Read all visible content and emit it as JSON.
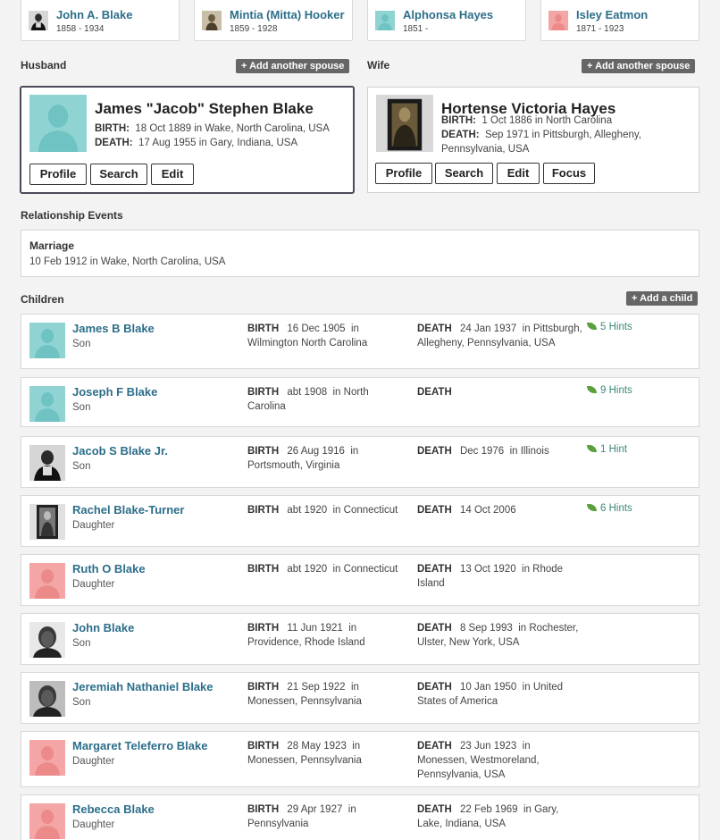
{
  "parents": [
    {
      "name": "John A. Blake",
      "years": "1858 - 1934",
      "avatar": "photo-dark"
    },
    {
      "name": "Mintia (Mitta) Hooker",
      "years": "1859 - 1928",
      "avatar": "photo-sepia"
    },
    {
      "name": "Alphonsa Hayes",
      "years": "1851 -",
      "avatar": "male"
    },
    {
      "name": "Isley Eatmon",
      "years": "1871 - 1923",
      "avatar": "female"
    }
  ],
  "husband": {
    "section_label": "Husband",
    "add_spouse_label": "+ Add another spouse",
    "name": "James \"Jacob\" Stephen Blake",
    "birth_label": "BIRTH:",
    "birth": "18 Oct 1889 in Wake, North Carolina, USA",
    "death_label": "DEATH:",
    "death": "17 Aug 1955 in Gary, Indiana, USA",
    "buttons": {
      "profile": "Profile",
      "search": "Search",
      "edit": "Edit"
    }
  },
  "wife": {
    "section_label": "Wife",
    "add_spouse_label": "+ Add another spouse",
    "name": "Hortense Victoria Hayes",
    "birth_label": "BIRTH:",
    "birth": "1 Oct 1886 in North Carolina",
    "death_label": "DEATH:",
    "death": "Sep 1971 in Pittsburgh, Allegheny, Pennsylvania, USA",
    "buttons": {
      "profile": "Profile",
      "search": "Search",
      "edit": "Edit",
      "focus": "Focus"
    }
  },
  "relationship_events": {
    "section_label": "Relationship Events",
    "title": "Marriage",
    "detail": "10 Feb 1912 in Wake, North Carolina, USA"
  },
  "children_section": {
    "label": "Children",
    "add_child_label": "+ Add a child",
    "birth_label": "BIRTH",
    "death_label": "DEATH"
  },
  "children": [
    {
      "name": "James B Blake",
      "relation": "Son",
      "birth": "16 Dec 1905",
      "birth_place": "in Wilmington North Carolina",
      "death": "24 Jan 1937",
      "death_place": "in Pittsburgh, Allegheny, Pennsylvania, USA",
      "hints": "5 Hints",
      "avatar": "male"
    },
    {
      "name": "Joseph F Blake",
      "relation": "Son",
      "birth": "abt 1908",
      "birth_place": "in North Carolina",
      "death": "",
      "death_place": "",
      "hints": "9 Hints",
      "avatar": "male"
    },
    {
      "name": "Jacob S Blake Jr.",
      "relation": "Son",
      "birth": "26 Aug 1916",
      "birth_place": "in Portsmouth, Virginia",
      "death": "Dec 1976",
      "death_place": "in Illinois",
      "hints": "1 Hint",
      "avatar": "photo-dark"
    },
    {
      "name": "Rachel Blake-Turner",
      "relation": "Daughter",
      "birth": "abt 1920",
      "birth_place": "in Connecticut",
      "death": "14 Oct 2006",
      "death_place": "",
      "hints": "6 Hints",
      "avatar": "photo-bw"
    },
    {
      "name": "Ruth O Blake",
      "relation": "Daughter",
      "birth": "abt 1920",
      "birth_place": "in Connecticut",
      "death": "13 Oct 1920",
      "death_place": "in Rhode Island",
      "hints": "",
      "avatar": "female"
    },
    {
      "name": "John Blake",
      "relation": "Son",
      "birth": "11 Jun 1921",
      "birth_place": "in Providence, Rhode Island",
      "death": "8 Sep 1993",
      "death_place": "in Rochester, Ulster, New York, USA",
      "hints": "",
      "avatar": "photo-portrait"
    },
    {
      "name": "Jeremiah Nathaniel Blake",
      "relation": "Son",
      "birth": "21 Sep 1922",
      "birth_place": "in Monessen, Pennsylvania",
      "death": "10 Jan 1950",
      "death_place": "in United States of America",
      "hints": "",
      "avatar": "photo-portrait2"
    },
    {
      "name": "Margaret Teleferro Blake",
      "relation": "Daughter",
      "birth": "28 May 1923",
      "birth_place": "in Monessen, Pennsylvania",
      "death": "23 Jun 1923",
      "death_place": "in Monessen, Westmoreland, Pennsylvania, USA",
      "hints": "",
      "avatar": "female"
    },
    {
      "name": "Rebecca Blake",
      "relation": "Daughter",
      "birth": "29 Apr 1927",
      "birth_place": "in Pennsylvania",
      "death": "22 Feb 1969",
      "death_place": "in Gary, Lake, Indiana, USA",
      "hints": "",
      "avatar": "female"
    }
  ],
  "colors": {
    "link": "#2c6e8a",
    "male_avatar": "#8fd3d3",
    "female_avatar": "#f4a6a6",
    "hint_green": "#5aa03c"
  }
}
